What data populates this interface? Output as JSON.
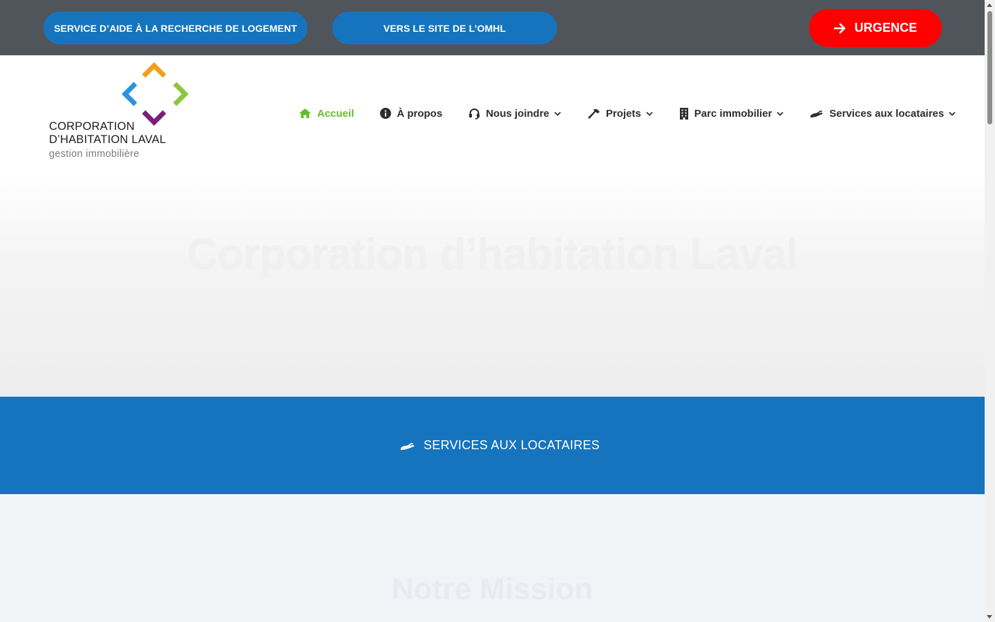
{
  "topbar": {
    "button_search": "SERVICE D’AIDE À LA RECHERCHE DE LOGEMENT",
    "button_omhl": "VERS LE SITE DE L’OMHL",
    "button_urgence": "URGENCE"
  },
  "logo": {
    "line1": "CORPORATION",
    "line2": "D’HABITATION LAVAL",
    "line3": "gestion immobilière"
  },
  "nav": {
    "items": [
      {
        "label": "Accueil",
        "icon": "home-icon",
        "active": true
      },
      {
        "label": "À propos",
        "icon": "info-icon"
      },
      {
        "label": "Nous joindre",
        "icon": "headset-icon",
        "dropdown": true
      },
      {
        "label": "Projets",
        "icon": "hammer-icon",
        "dropdown": true
      },
      {
        "label": "Parc immobilier",
        "icon": "building-icon",
        "dropdown": true
      },
      {
        "label": "Services aux locataires",
        "icon": "hand-icon",
        "dropdown": true
      }
    ]
  },
  "hero": {
    "title": "Corporation d’habitation Laval"
  },
  "band": {
    "link_label": "SERVICES AUX LOCATAIRES",
    "icon": "hand-holding-icon"
  },
  "mission": {
    "title": "Notre Mission"
  },
  "colors": {
    "topbar_bg": "#50555b",
    "blue": "#1674be",
    "red": "#ff0000",
    "active_green": "#65bc2b",
    "logo_orange": "#f29f1b",
    "logo_blue": "#2c93dd",
    "logo_green": "#8cc63f",
    "logo_purple": "#7b1f7e"
  }
}
